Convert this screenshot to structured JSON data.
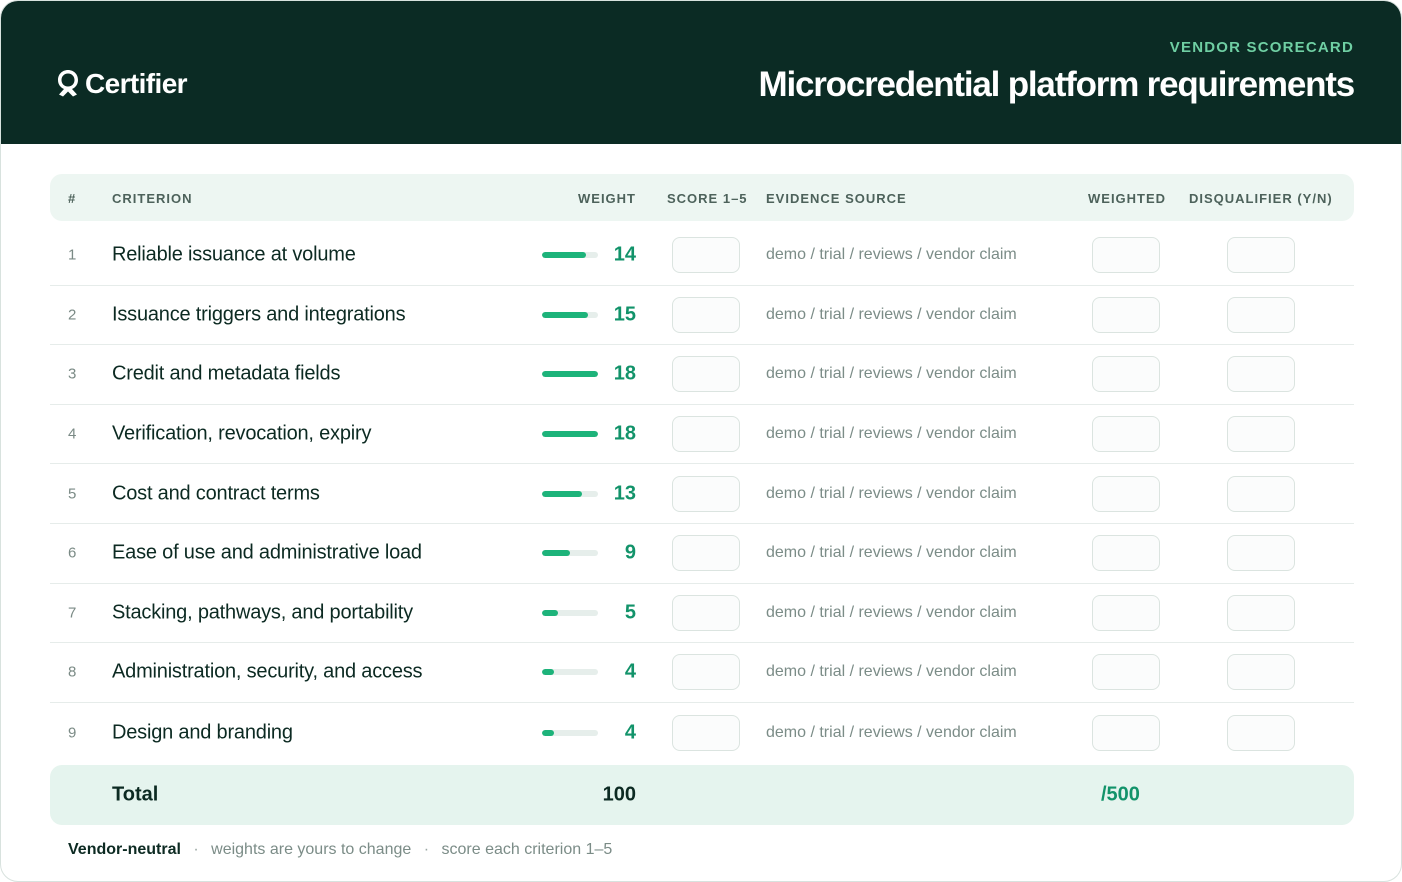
{
  "header": {
    "brand": "Certifier",
    "eyebrow": "VENDOR SCORECARD",
    "title": "Microcredential platform requirements",
    "colors": {
      "background": "#0b2b24",
      "accent": "#6fcfa3"
    },
    "logo_icon": "certifier-badge-icon"
  },
  "table": {
    "columns": {
      "num": "#",
      "criterion": "CRITERION",
      "weight": "WEIGHT",
      "score": "SCORE 1–5",
      "evidence": "EVIDENCE SOURCE",
      "weighted": "WEIGHTED",
      "disqualifier": "DISQUALIFIER (Y/N)"
    },
    "max_weight": 18,
    "rows": [
      {
        "num": "1",
        "criterion": "Reliable issuance at volume",
        "weight": "14",
        "weight_value": 14,
        "evidence": "demo / trial / reviews / vendor claim"
      },
      {
        "num": "2",
        "criterion": "Issuance triggers and integrations",
        "weight": "15",
        "weight_value": 15,
        "evidence": "demo / trial / reviews / vendor claim"
      },
      {
        "num": "3",
        "criterion": "Credit and metadata fields",
        "weight": "18",
        "weight_value": 18,
        "evidence": "demo / trial / reviews / vendor claim"
      },
      {
        "num": "4",
        "criterion": "Verification, revocation, expiry",
        "weight": "18",
        "weight_value": 18,
        "evidence": "demo / trial / reviews / vendor claim"
      },
      {
        "num": "5",
        "criterion": "Cost and contract terms",
        "weight": "13",
        "weight_value": 13,
        "evidence": "demo / trial / reviews / vendor claim"
      },
      {
        "num": "6",
        "criterion": "Ease of use and administrative load",
        "weight": "9",
        "weight_value": 9,
        "evidence": "demo / trial / reviews / vendor claim"
      },
      {
        "num": "7",
        "criterion": "Stacking, pathways, and portability",
        "weight": "5",
        "weight_value": 5,
        "evidence": "demo / trial / reviews / vendor claim"
      },
      {
        "num": "8",
        "criterion": "Administration, security, and access",
        "weight": "4",
        "weight_value": 4,
        "evidence": "demo / trial / reviews / vendor claim"
      },
      {
        "num": "9",
        "criterion": "Design and branding",
        "weight": "4",
        "weight_value": 4,
        "evidence": "demo / trial / reviews / vendor claim"
      }
    ],
    "total": {
      "label": "Total",
      "weight": "100",
      "max": "/500"
    }
  },
  "footer": {
    "lead": "Vendor-neutral",
    "separator": "·",
    "note1": "weights are yours to change",
    "note2": "score each criterion 1–5"
  }
}
